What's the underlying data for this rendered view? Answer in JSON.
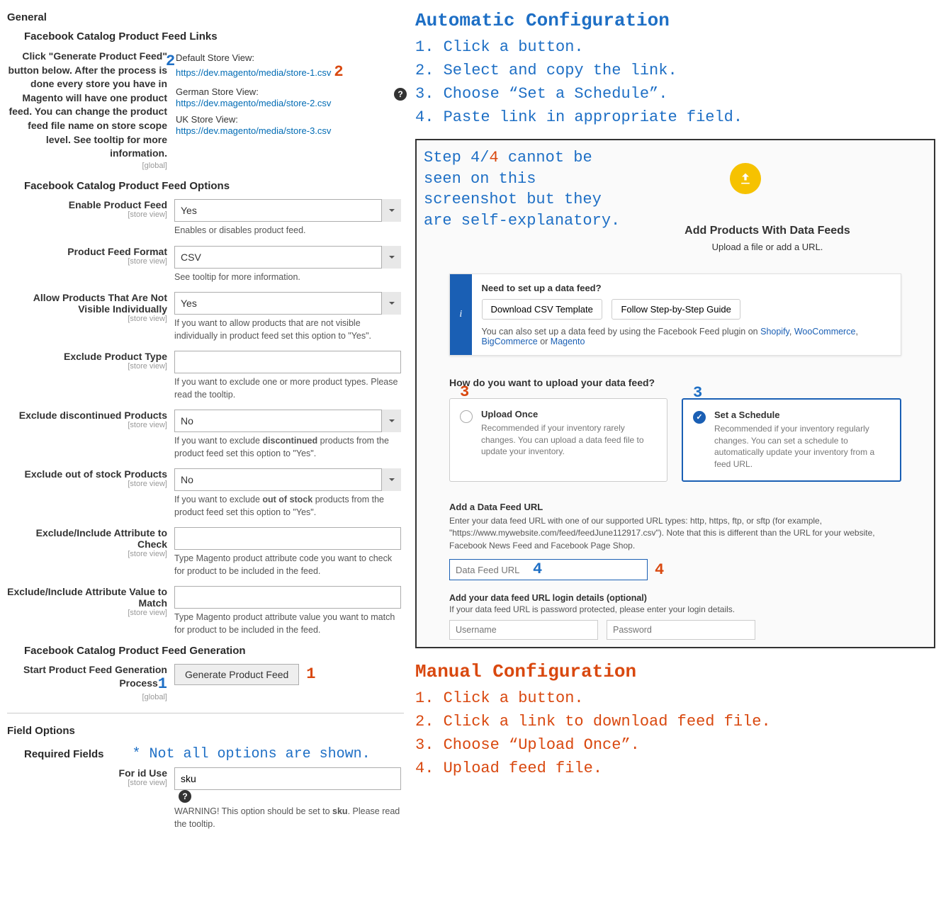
{
  "general": {
    "title": "General",
    "links": {
      "title": "Facebook Catalog Product Feed Links",
      "instruction": "Click \"Generate Product Feed\" button below. After the process is done every store you have in Magento will have one product feed. You can change the product feed file name on store scope level. See tooltip for more information.",
      "scope": "[global]",
      "stores": [
        {
          "label": "Default Store View:",
          "url": "https://dev.magento/media/store-1.csv"
        },
        {
          "label": "German Store View:",
          "url": "https://dev.magento/media/store-2.csv"
        },
        {
          "label": "UK Store View:",
          "url": "https://dev.magento/media/store-3.csv"
        }
      ]
    },
    "options": {
      "title": "Facebook Catalog Product Feed Options",
      "enable": {
        "label": "Enable Product Feed",
        "scope": "[store view]",
        "value": "Yes",
        "hint": "Enables or disables product feed."
      },
      "format": {
        "label": "Product Feed Format",
        "scope": "[store view]",
        "value": "CSV",
        "hint": "See tooltip for more information."
      },
      "allow_not_visible": {
        "label": "Allow Products That Are Not Visible Individually",
        "scope": "[store view]",
        "value": "Yes",
        "hint": "If you want to allow products that are not visible individually in product feed set this option to \"Yes\"."
      },
      "exclude_type": {
        "label": "Exclude Product Type",
        "scope": "[store view]",
        "value": "",
        "hint": "If you want to exclude one or more product types. Please read the tooltip."
      },
      "exclude_discontinued": {
        "label": "Exclude discontinued Products",
        "scope": "[store view]",
        "value": "No",
        "hint_pre": "If you want to exclude ",
        "hint_b": "discontinued",
        "hint_post": " products from the product feed set this option to \"Yes\"."
      },
      "exclude_oos": {
        "label": "Exclude out of stock Products",
        "scope": "[store view]",
        "value": "No",
        "hint_pre": "If you want to exclude ",
        "hint_b": "out of stock",
        "hint_post": " products from the product feed set this option to \"Yes\"."
      },
      "attr_check": {
        "label": "Exclude/Include Attribute to Check",
        "scope": "[store view]",
        "value": "",
        "hint": "Type Magento product attribute code you want to check for product to be included in the feed."
      },
      "attr_value": {
        "label": "Exclude/Include Attribute Value to Match",
        "scope": "[store view]",
        "value": "",
        "hint": "Type Magento product attribute value you want to match for product to be included in the feed."
      }
    },
    "generation": {
      "title": "Facebook Catalog Product Feed Generation",
      "label": "Start Product Feed Generation Process",
      "scope": "[global]",
      "button": "Generate Product Feed"
    },
    "field_options": {
      "title": "Field Options",
      "required_title": "Required Fields",
      "note": "* Not all options are shown.",
      "id_use": {
        "label": "For id Use",
        "scope": "[store view]",
        "value": "sku",
        "hint": "WARNING! This option should be set to sku. Please read the tooltip.",
        "hint_b": "sku"
      }
    }
  },
  "annotations": {
    "two_label": "2",
    "two_url": "2",
    "one_button": "1",
    "one_after": "1",
    "three": "3",
    "four_in": "4",
    "four_after": "4"
  },
  "right": {
    "auto": {
      "title": "Automatic Configuration",
      "steps": [
        "1. Click a button.",
        "2. Select and copy the link.",
        "3. Choose “Set a Schedule”.",
        "4. Paste link in appropriate field."
      ]
    },
    "panel": {
      "note_pre": "Step 4/",
      "note_red": "4",
      "note_post": " cannot be seen on this screenshot but they are self-explanatory.",
      "head_title": "Add Products With Data Feeds",
      "head_sub": "Upload a file or add a URL.",
      "banner": {
        "title": "Need to set up a data feed?",
        "btn1": "Download CSV Template",
        "btn2": "Follow Step-by-Step Guide",
        "foot_pre": "You can also set up a data feed by using the Facebook Feed plugin on ",
        "links": [
          "Shopify",
          "WooCommerce",
          "BigCommerce",
          "Magento"
        ],
        "sep_comma": ", ",
        "sep_or": " or "
      },
      "question": "How do you want to upload your data feed?",
      "card1": {
        "title": "Upload Once",
        "desc": "Recommended if your inventory rarely changes. You can upload a data feed file to update your inventory."
      },
      "card2": {
        "title": "Set a Schedule",
        "desc": "Recommended if your inventory regularly changes. You can set a schedule to automatically update your inventory from a feed URL."
      },
      "feed_url": {
        "title": "Add a Data Feed URL",
        "desc": "Enter your data feed URL with one of our supported URL types: http, https, ftp, or sftp (for example, \"https://www.mywebsite.com/feed/feedJune112917.csv\"). Note that this is different than the URL for your website, Facebook News Feed and Facebook Page Shop.",
        "placeholder": "Data Feed URL"
      },
      "login": {
        "title": "Add your data feed URL login details (optional)",
        "sub": "If your data feed URL is password protected, please enter your login details.",
        "user_ph": "Username",
        "pass_ph": "Password"
      }
    },
    "manual": {
      "title": "Manual Configuration",
      "steps": [
        "1. Click a button.",
        "2. Click a link to download feed file.",
        "3. Choose “Upload Once”.",
        "4. Upload feed file."
      ]
    }
  }
}
